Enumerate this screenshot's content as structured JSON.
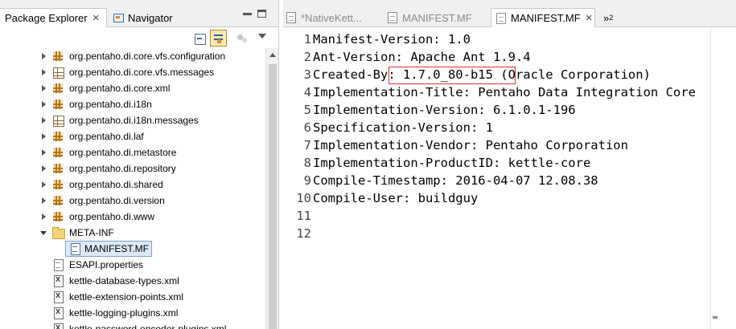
{
  "left_panel": {
    "tabs": [
      {
        "label": "Package Explorer",
        "close": "✕",
        "active": true
      },
      {
        "label": "Navigator",
        "active": false
      }
    ]
  },
  "tree": [
    {
      "label": "org.pentaho.di.core.vfs.configuration",
      "icon": "package-icon",
      "indent": 1,
      "expander": "collapsed"
    },
    {
      "label": "org.pentaho.di.core.vfs.messages",
      "icon": "resource-package-icon",
      "indent": 1,
      "expander": "collapsed"
    },
    {
      "label": "org.pentaho.di.core.xml",
      "icon": "package-icon",
      "indent": 1,
      "expander": "collapsed"
    },
    {
      "label": "org.pentaho.di.i18n",
      "icon": "package-icon",
      "indent": 1,
      "expander": "collapsed"
    },
    {
      "label": "org.pentaho.di.i18n.messages",
      "icon": "resource-package-icon",
      "indent": 1,
      "expander": "collapsed"
    },
    {
      "label": "org.pentaho.di.laf",
      "icon": "package-icon",
      "indent": 1,
      "expander": "collapsed"
    },
    {
      "label": "org.pentaho.di.metastore",
      "icon": "package-icon",
      "indent": 1,
      "expander": "collapsed"
    },
    {
      "label": "org.pentaho.di.repository",
      "icon": "package-icon",
      "indent": 1,
      "expander": "collapsed"
    },
    {
      "label": "org.pentaho.di.shared",
      "icon": "package-icon",
      "indent": 1,
      "expander": "collapsed"
    },
    {
      "label": "org.pentaho.di.version",
      "icon": "package-icon",
      "indent": 1,
      "expander": "collapsed"
    },
    {
      "label": "org.pentaho.di.www",
      "icon": "package-icon",
      "indent": 1,
      "expander": "collapsed"
    },
    {
      "label": "META-INF",
      "icon": "folder-icon",
      "indent": 1,
      "expander": "expanded"
    },
    {
      "label": "MANIFEST.MF",
      "icon": "manifest-file-icon",
      "indent": 2,
      "expander": "none",
      "selected": true
    },
    {
      "label": "ESAPI.properties",
      "icon": "file-icon",
      "indent": 1,
      "expander": "none"
    },
    {
      "label": "kettle-database-types.xml",
      "icon": "xml-file-icon",
      "indent": 1,
      "expander": "none"
    },
    {
      "label": "kettle-extension-points.xml",
      "icon": "xml-file-icon",
      "indent": 1,
      "expander": "none"
    },
    {
      "label": "kettle-logging-plugins.xml",
      "icon": "xml-file-icon",
      "indent": 1,
      "expander": "none"
    },
    {
      "label": "kettle-password-encoder-plugins.xml",
      "icon": "xml-file-icon",
      "indent": 1,
      "expander": "none"
    }
  ],
  "editor": {
    "tabs": [
      {
        "label": "*NativeKett...",
        "active": false
      },
      {
        "label": "MANIFEST.MF",
        "active": false
      },
      {
        "label": "MANIFEST.MF",
        "close": "✕",
        "active": true
      }
    ],
    "overflow_label": "»",
    "overflow_count": "2",
    "lines": [
      {
        "n": "1",
        "text": "Manifest-Version: 1.0"
      },
      {
        "n": "2",
        "text": "Ant-Version: Apache Ant 1.9.4"
      },
      {
        "n": "3",
        "text": "Created-By: 1.7.0_80-b15 (Oracle Corporation)"
      },
      {
        "n": "4",
        "text": "Implementation-Title: Pentaho Data Integration Core"
      },
      {
        "n": "5",
        "text": "Implementation-Version: 6.1.0.1-196"
      },
      {
        "n": "6",
        "text": "Specification-Version: 1"
      },
      {
        "n": "7",
        "text": "Implementation-Vendor: Pentaho Corporation"
      },
      {
        "n": "8",
        "text": "Implementation-ProductID: kettle-core"
      },
      {
        "n": "9",
        "text": "Compile-Timestamp: 2016-04-07 12.08.38"
      },
      {
        "n": "10",
        "text": "Compile-User: buildguy"
      },
      {
        "n": "11",
        "text": ""
      },
      {
        "n": "12",
        "text": ""
      }
    ]
  },
  "colors": {
    "selection_bg": "#dce9f7",
    "selection_border": "#7da2ce",
    "highlight_box": "#e03030"
  }
}
